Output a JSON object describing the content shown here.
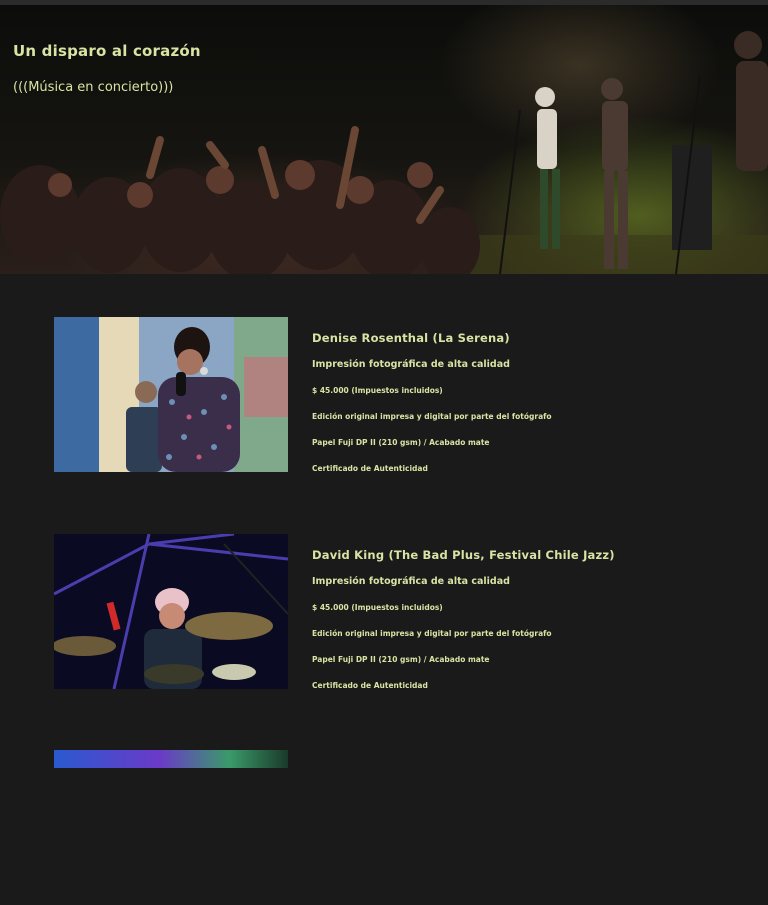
{
  "hero": {
    "title": "Un disparo al corazón",
    "subtitle": "(((Música en concierto)))"
  },
  "products": [
    {
      "name": "Denise Rosenthal (La Serena)",
      "print": "Impresión fotográfica de alta calidad",
      "price": "$ 45.000 (Impuestos incluidos)",
      "edition": "Edición original impresa y digital por parte del fotógrafo",
      "paper": "Papel Fuji DP II (210 gsm) / Acabado mate",
      "certificate": "Certificado de Autenticidad"
    },
    {
      "name": "David King (The Bad Plus, Festival Chile Jazz)",
      "print": "Impresión fotográfica de alta calidad",
      "price": "$ 45.000 (Impuestos incluidos)",
      "edition": "Edición original impresa y digital por parte del fotógrafo",
      "paper": "Papel Fuji DP II (210 gsm) / Acabado mate",
      "certificate": "Certificado de Autenticidad"
    }
  ],
  "colors": {
    "background": "#1a1a1b",
    "text_accent": "#d9e3a3"
  }
}
